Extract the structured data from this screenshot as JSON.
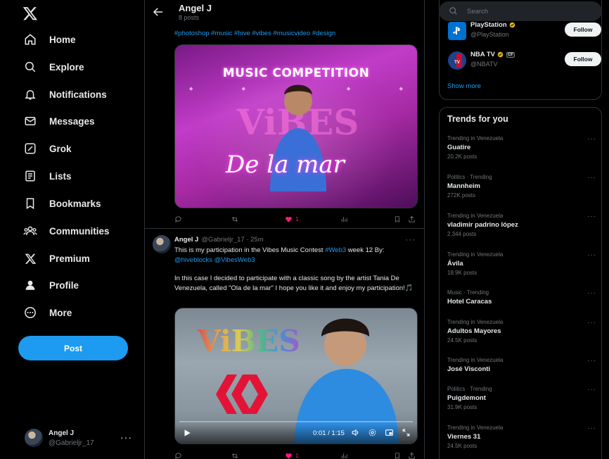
{
  "nav": {
    "items": [
      {
        "label": "Home",
        "icon": "home-icon"
      },
      {
        "label": "Explore",
        "icon": "search-icon"
      },
      {
        "label": "Notifications",
        "icon": "bell-icon"
      },
      {
        "label": "Messages",
        "icon": "envelope-icon"
      },
      {
        "label": "Grok",
        "icon": "grok-icon"
      },
      {
        "label": "Lists",
        "icon": "list-icon"
      },
      {
        "label": "Bookmarks",
        "icon": "bookmark-icon"
      },
      {
        "label": "Communities",
        "icon": "people-icon"
      },
      {
        "label": "Premium",
        "icon": "x-logo-icon"
      },
      {
        "label": "Profile",
        "icon": "person-icon"
      },
      {
        "label": "More",
        "icon": "more-circle-icon"
      }
    ],
    "post_label": "Post",
    "account": {
      "name": "Angel J",
      "handle": "@Gabrieljr_17",
      "more": "···"
    }
  },
  "header": {
    "title": "Angel J",
    "subtitle": "8 posts"
  },
  "post1": {
    "hashtags": "#photoshop #music #hive #vibes #musicvideo #design",
    "image_text": {
      "headline": "MUSIC COMPETITION",
      "brand": "ViBES",
      "script": "De la mar"
    },
    "likes": "1"
  },
  "post2": {
    "name": "Angel J",
    "handle_time": "@Gabrieljr_17 · 25m",
    "more": "···",
    "line1_pre": "This is my participation in the Vibes Music Contest ",
    "line1_link": "#Web3",
    "line1_post": " week 12 By:",
    "line2_link1": "@hiveblocks",
    "line2_link2": "@VibesWeb3",
    "para2": "In this case I decided to participate with a classic song by the artist Tania De Venezuela, called \"Ola de la mar\" I hope you like it and enjoy my participation!🎵",
    "video": {
      "brand": "ViBES",
      "time": "0:01 / 1:15"
    },
    "likes": "1"
  },
  "sidebar": {
    "search_placeholder": "Search",
    "who_to_follow": [
      {
        "name": "PlayStation",
        "handle": "@PlayStation",
        "button": "Follow",
        "logo_color": "#0070d1"
      },
      {
        "name": "NBA TV",
        "handle": "@NBATV",
        "affiliate": "CF",
        "button": "Follow",
        "logo_color": "#1d428a"
      }
    ],
    "show_more": "Show more",
    "trends_title": "Trends for you",
    "trends": [
      {
        "context": "Trending in Venezuela",
        "topic": "Guatire",
        "count": "20.2K posts"
      },
      {
        "context": "Politics · Trending",
        "topic": "Mannheim",
        "count": "272K posts"
      },
      {
        "context": "Trending in Venezuela",
        "topic": "vladimir padrino lópez",
        "count": "2,344 posts"
      },
      {
        "context": "Trending in Venezuela",
        "topic": "Ávila",
        "count": "18.9K posts"
      },
      {
        "context": "Music · Trending",
        "topic": "Hotel Caracas",
        "count": ""
      },
      {
        "context": "Trending in Venezuela",
        "topic": "Adultos Mayores",
        "count": "24.5K posts"
      },
      {
        "context": "Trending in Venezuela",
        "topic": "José Visconti",
        "count": ""
      },
      {
        "context": "Politics · Trending",
        "topic": "Puigdemont",
        "count": "31.9K posts"
      },
      {
        "context": "Trending in Venezuela",
        "topic": "Viernes 31",
        "count": "24.5K posts"
      }
    ]
  },
  "colors": {
    "accent": "#1d9bf0",
    "like": "#f91880",
    "background": "#000000",
    "border": "#2f3336",
    "muted": "#71767b"
  }
}
